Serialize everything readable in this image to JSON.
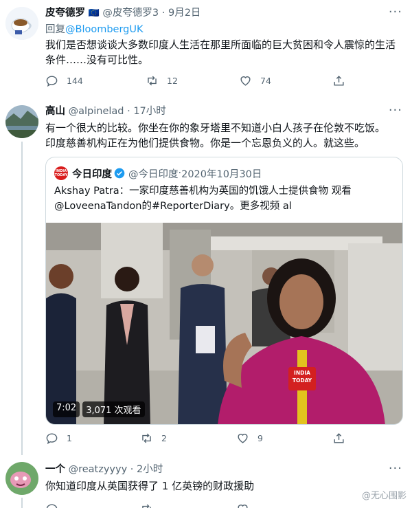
{
  "tweet1": {
    "name": "皮夸德罗",
    "flag": "🇪🇺",
    "handle": "@皮夸德罗3",
    "dot": "·",
    "time": "9月2日",
    "reply_prefix": "回复",
    "reply_to": "@BloombergUK",
    "text": "我们是否想谈谈大多数印度人生活在那里所面临的巨大贫困和令人震惊的生活条件……没有可比性。",
    "replies": "144",
    "retweets": "12",
    "likes": "74"
  },
  "tweet2": {
    "name": "高山",
    "handle": "@alpinelad",
    "dot": "·",
    "time": "17小时",
    "text_line1": "有一个很大的比较。你坐在你的象牙塔里不知道小白人孩子在伦敦不吃饭。",
    "text_line2": "印度慈善机构正在为他们提供食物。你是一个忘恩负义的人。就这些。",
    "quote": {
      "logo_line1": "INDIA",
      "logo_line2": "TODAY",
      "name": "今日印度",
      "handle": "@今日印度",
      "dot": "·",
      "time": "2020年10月30日",
      "text": "Akshay Patra：一家印度慈善机构为英国的饥饿人士提供食物 观看@LoveenaTandon的#ReporterDiary。更多视频 al",
      "video_duration": "7:02",
      "video_views": "3,071 次观看",
      "mic_label_line1": "INDIA",
      "mic_label_line2": "TODAY"
    },
    "replies": "1",
    "retweets": "2",
    "likes": "9"
  },
  "tweet3": {
    "name": "一个",
    "handle": "@reatzyyyy",
    "dot": "·",
    "time": "2小时",
    "text": "你知道印度从英国获得了 1 亿英镑的财政援助"
  },
  "watermark": "@无心围影",
  "colors": {
    "link": "#1d9bf0",
    "secondary": "#536471",
    "verified": "#1d9bf0",
    "brand_red": "#d91c1c"
  }
}
